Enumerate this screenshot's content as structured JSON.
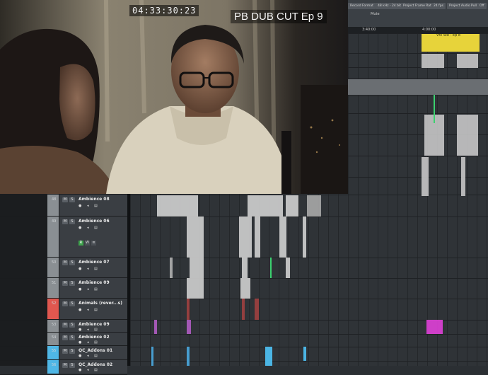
{
  "video": {
    "timecode": "04:33:30:23",
    "burnin_title": "PB DUB CUT Ep 9"
  },
  "toolbar": {
    "items": [
      "Record Format",
      "48 kHz - 24 bit",
      "Project Frame Rate",
      "24 fps",
      "Project Audio Pull",
      "Off"
    ],
    "mute_label": "Mute"
  },
  "ruler": {
    "marks": [
      "3:40:00",
      "4:00:00"
    ]
  },
  "clip_label": "Vfx Ste - Ep 8",
  "tracks": [
    {
      "number": "48",
      "name": "Ambience 08",
      "m": "M",
      "s": "S",
      "r": "R",
      "w": "W",
      "color": "#8a8f93"
    },
    {
      "number": "49",
      "name": "Ambience 06",
      "m": "M",
      "s": "S",
      "r": "R",
      "w": "W",
      "color": "#8a8f93"
    },
    {
      "number": "50",
      "name": "Ambience 07",
      "m": "M",
      "s": "S",
      "r": "R",
      "w": "W",
      "color": "#8a8f93"
    },
    {
      "number": "51",
      "name": "Ambience 09",
      "m": "M",
      "s": "S",
      "r": "R",
      "w": "W",
      "color": "#8a8f93"
    },
    {
      "number": "52",
      "name": "Animals (rever...s)",
      "m": "M",
      "s": "S",
      "r": "R",
      "w": "W",
      "color": "#e0574f"
    },
    {
      "number": "53",
      "name": "Ambience 09",
      "m": "M",
      "s": "S",
      "r": "R",
      "w": "W",
      "color": "#8a8f93"
    },
    {
      "number": "54",
      "name": "Ambience 02",
      "m": "M",
      "s": "S",
      "r": "R",
      "w": "W",
      "color": "#8a8f93"
    },
    {
      "number": "55",
      "name": "QC_Addons 01",
      "m": "M",
      "s": "S",
      "r": "R",
      "w": "W",
      "color": "#4fb7e6"
    },
    {
      "number": "56",
      "name": "QC_Addons 02",
      "m": "M",
      "s": "S",
      "r": "R",
      "w": "W",
      "color": "#4fb7e6"
    }
  ]
}
